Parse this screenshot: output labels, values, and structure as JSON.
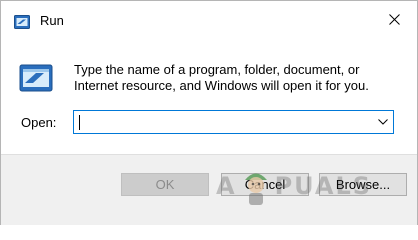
{
  "window": {
    "title": "Run"
  },
  "icons": {
    "app": "run-app-icon",
    "big": "run-dialog-icon",
    "close": "close-icon",
    "dropdown": "chevron-down-icon"
  },
  "main": {
    "description": "Type the name of a program, folder, document, or Internet resource, and Windows will open it for you.",
    "open_label": "Open:",
    "open_value": ""
  },
  "buttons": {
    "ok": "OK",
    "cancel": "Cancel",
    "browse": "Browse..."
  },
  "watermark": {
    "prefix": "A",
    "suffix": "PUALS"
  },
  "colors": {
    "accent": "#0078d7",
    "footer_bg": "#f0f0f0",
    "disabled_button": "#cccccc"
  }
}
